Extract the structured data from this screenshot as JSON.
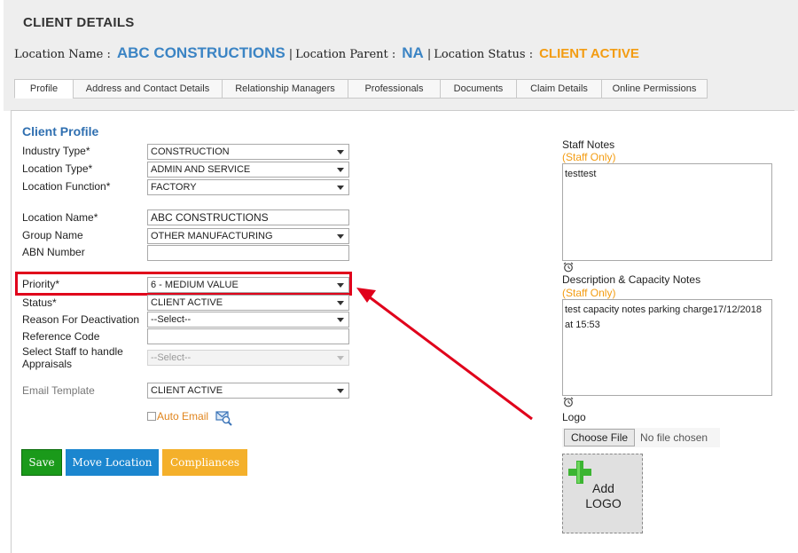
{
  "header": {
    "title": "CLIENT DETAILS",
    "location_name_label": "Location Name :",
    "location_name_value": "ABC CONSTRUCTIONS",
    "separator": "|",
    "location_parent_label": "Location Parent :",
    "location_parent_value": "NA",
    "location_status_label": "Location Status :",
    "location_status_value": "CLIENT ACTIVE"
  },
  "tabs": [
    {
      "label": "Profile"
    },
    {
      "label": "Address and Contact Details"
    },
    {
      "label": "Relationship Managers"
    },
    {
      "label": "Professionals"
    },
    {
      "label": "Documents"
    },
    {
      "label": "Claim Details"
    },
    {
      "label": "Online Permissions"
    }
  ],
  "form": {
    "section_title": "Client Profile",
    "industry_type": {
      "label": "Industry Type*",
      "value": "CONSTRUCTION"
    },
    "location_type": {
      "label": "Location Type*",
      "value": "ADMIN AND SERVICE"
    },
    "location_function": {
      "label": "Location Function*",
      "value": "FACTORY"
    },
    "location_name": {
      "label": "Location Name*",
      "value": "ABC CONSTRUCTIONS"
    },
    "group_name": {
      "label": "Group Name",
      "value": "OTHER MANUFACTURING"
    },
    "abn_number": {
      "label": "ABN Number",
      "value": ""
    },
    "priority": {
      "label": "Priority*",
      "value": "6 - MEDIUM VALUE"
    },
    "status": {
      "label": "Status*",
      "value": "CLIENT ACTIVE"
    },
    "reason_for_deactivation": {
      "label": "Reason For Deactivation",
      "value": "--Select--"
    },
    "reference_code": {
      "label": "Reference Code",
      "value": ""
    },
    "select_staff": {
      "label_line1": "Select Staff to handle",
      "label_line2": "Appraisals",
      "value": "--Select--"
    },
    "email_template": {
      "label": "Email Template",
      "value": "CLIENT ACTIVE"
    },
    "auto_email_label": "Auto Email"
  },
  "buttons": {
    "save": "Save",
    "move_location": "Move Location",
    "compliances": "Compliances"
  },
  "right": {
    "staff_notes_label": "Staff Notes",
    "staff_only": "(Staff Only)",
    "staff_notes_value": "testtest",
    "capacity_notes_label": "Description & Capacity Notes",
    "capacity_notes_value": "test capacity notes parking charge17/12/2018 at 15:53",
    "logo_label": "Logo",
    "choose_file": "Choose File",
    "no_file": "No file chosen",
    "add_logo_line1": "Add",
    "add_logo_line2": "LOGO"
  },
  "colors": {
    "accent_blue": "#3b84c4",
    "status_orange": "#f39c12",
    "highlight_red": "#e0001b",
    "save_green": "#1a9a1a",
    "move_blue": "#1b86cf",
    "compliances_orange": "#f4b02b"
  },
  "icons": [
    "caret-down-icon",
    "checkbox-icon",
    "mail-search-icon",
    "alarm-clock-icon",
    "plus-icon",
    "annotation-arrow"
  ]
}
